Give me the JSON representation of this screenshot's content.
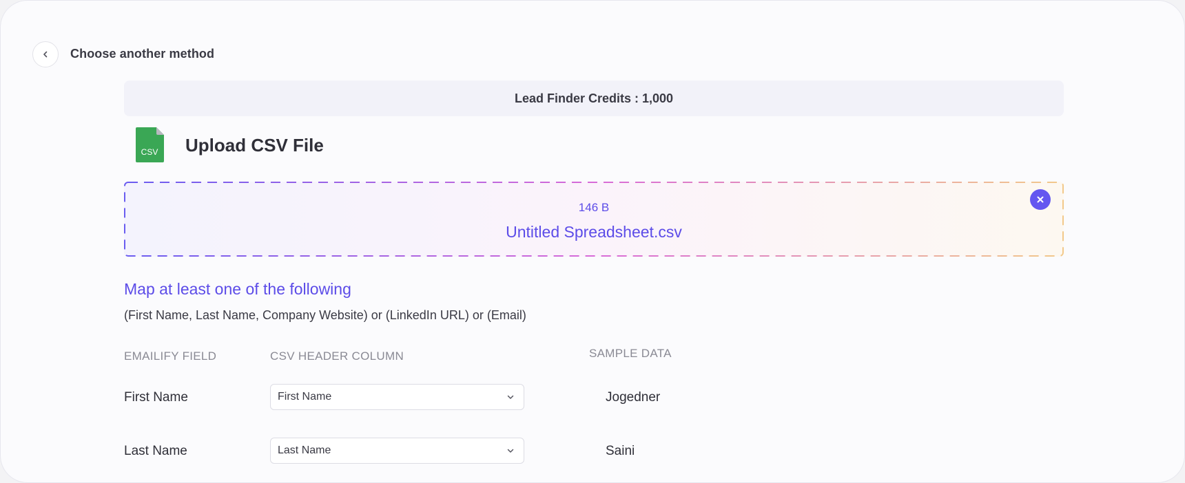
{
  "nav": {
    "back_label": "Choose another method",
    "back_icon": "chevron-left-icon"
  },
  "credits": {
    "text": "Lead Finder Credits : 1,000"
  },
  "upload": {
    "icon": "csv-file-icon",
    "icon_text": "CSV",
    "icon_color": "#3aa755",
    "title": "Upload CSV File"
  },
  "file": {
    "size": "146 B",
    "name": "Untitled Spreadsheet.csv",
    "remove_icon": "close-icon"
  },
  "mapping": {
    "title": "Map at least one of the following",
    "subtitle": "(First Name, Last Name, Company Website) or (LinkedIn URL) or (Email)",
    "headers": {
      "field": "EMAILIFY FIELD",
      "csv_column": "CSV HEADER COLUMN",
      "sample": "SAMPLE DATA"
    },
    "rows": [
      {
        "field": "First Name",
        "selected": "First Name",
        "sample": "Jogedner"
      },
      {
        "field": "Last Name",
        "selected": "Last Name",
        "sample": "Saini"
      }
    ]
  },
  "colors": {
    "accent": "#5c4ce8",
    "accent_button": "#6456f0",
    "border_gradient": [
      "#6a5cf0",
      "#d86ad8",
      "#f2c98a"
    ]
  }
}
